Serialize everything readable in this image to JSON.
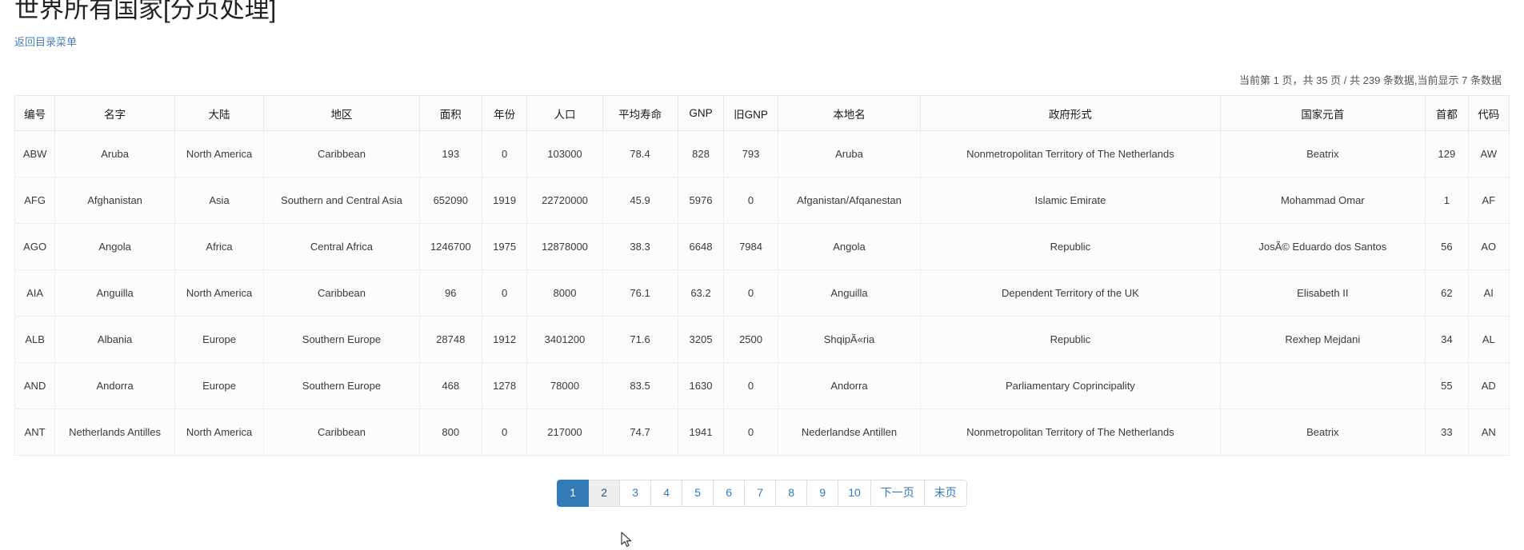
{
  "page": {
    "title": "世界所有国家[分页处理]",
    "back_link": "返回目录菜单",
    "status": "当前第 1 页，共 35 页 / 共 239 条数据,当前显示 7 条数据"
  },
  "table": {
    "columns": [
      "编号",
      "名字",
      "大陆",
      "地区",
      "面积",
      "年份",
      "人口",
      "平均寿命",
      "GNP",
      "旧GNP",
      "本地名",
      "政府形式",
      "国家元首",
      "首都",
      "代码"
    ],
    "rows": [
      {
        "code": "ABW",
        "name": "Aruba",
        "continent": "North America",
        "region": "Caribbean",
        "area": "193",
        "year": "0",
        "population": "103000",
        "life_expectancy": "78.4",
        "gnp": "828",
        "gnp_old": "793",
        "local_name": "Aruba",
        "government_form": "Nonmetropolitan Territory of The Netherlands",
        "head_of_state": "Beatrix",
        "capital": "129",
        "code2": "AW"
      },
      {
        "code": "AFG",
        "name": "Afghanistan",
        "continent": "Asia",
        "region": "Southern and Central Asia",
        "area": "652090",
        "year": "1919",
        "population": "22720000",
        "life_expectancy": "45.9",
        "gnp": "5976",
        "gnp_old": "0",
        "local_name": "Afganistan/Afqanestan",
        "government_form": "Islamic Emirate",
        "head_of_state": "Mohammad Omar",
        "capital": "1",
        "code2": "AF"
      },
      {
        "code": "AGO",
        "name": "Angola",
        "continent": "Africa",
        "region": "Central Africa",
        "area": "1246700",
        "year": "1975",
        "population": "12878000",
        "life_expectancy": "38.3",
        "gnp": "6648",
        "gnp_old": "7984",
        "local_name": "Angola",
        "government_form": "Republic",
        "head_of_state": "JosÃ© Eduardo dos Santos",
        "capital": "56",
        "code2": "AO"
      },
      {
        "code": "AIA",
        "name": "Anguilla",
        "continent": "North America",
        "region": "Caribbean",
        "area": "96",
        "year": "0",
        "population": "8000",
        "life_expectancy": "76.1",
        "gnp": "63.2",
        "gnp_old": "0",
        "local_name": "Anguilla",
        "government_form": "Dependent Territory of the UK",
        "head_of_state": "Elisabeth II",
        "capital": "62",
        "code2": "AI"
      },
      {
        "code": "ALB",
        "name": "Albania",
        "continent": "Europe",
        "region": "Southern Europe",
        "area": "28748",
        "year": "1912",
        "population": "3401200",
        "life_expectancy": "71.6",
        "gnp": "3205",
        "gnp_old": "2500",
        "local_name": "ShqipÃ«ria",
        "government_form": "Republic",
        "head_of_state": "Rexhep Mejdani",
        "capital": "34",
        "code2": "AL"
      },
      {
        "code": "AND",
        "name": "Andorra",
        "continent": "Europe",
        "region": "Southern Europe",
        "area": "468",
        "year": "1278",
        "population": "78000",
        "life_expectancy": "83.5",
        "gnp": "1630",
        "gnp_old": "0",
        "local_name": "Andorra",
        "government_form": "Parliamentary Coprincipality",
        "head_of_state": "",
        "capital": "55",
        "code2": "AD"
      },
      {
        "code": "ANT",
        "name": "Netherlands Antilles",
        "continent": "North America",
        "region": "Caribbean",
        "area": "800",
        "year": "0",
        "population": "217000",
        "life_expectancy": "74.7",
        "gnp": "1941",
        "gnp_old": "0",
        "local_name": "Nederlandse Antillen",
        "government_form": "Nonmetropolitan Territory of The Netherlands",
        "head_of_state": "Beatrix",
        "capital": "33",
        "code2": "AN"
      }
    ]
  },
  "pagination": {
    "items": [
      {
        "label": "1",
        "state": "active"
      },
      {
        "label": "2",
        "state": "hovered"
      },
      {
        "label": "3",
        "state": "normal"
      },
      {
        "label": "4",
        "state": "normal"
      },
      {
        "label": "5",
        "state": "normal"
      },
      {
        "label": "6",
        "state": "normal"
      },
      {
        "label": "7",
        "state": "normal"
      },
      {
        "label": "8",
        "state": "normal"
      },
      {
        "label": "9",
        "state": "normal"
      },
      {
        "label": "10",
        "state": "normal"
      },
      {
        "label": "下一页",
        "state": "normal"
      },
      {
        "label": "末页",
        "state": "normal"
      }
    ],
    "active_color": "#337ab7",
    "link_color": "#337ab7"
  }
}
